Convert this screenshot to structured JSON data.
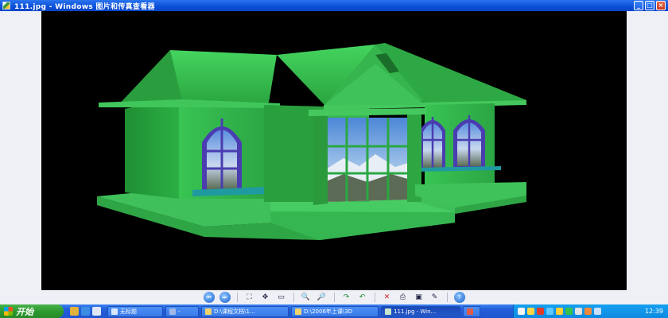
{
  "window": {
    "title": "111.jpg - Windows 图片和传真查看器",
    "minimize": "_",
    "maximize": "□",
    "close": "×"
  },
  "viewer": {
    "image_subject": "3D rendered green house"
  },
  "toolbar": {
    "buttons": [
      {
        "name": "previous-image-button",
        "icon": "prev-icon",
        "glyph": "⏮"
      },
      {
        "name": "next-image-button",
        "icon": "next-icon",
        "glyph": "⏭"
      },
      {
        "name": "best-fit-button",
        "icon": "best-fit-icon",
        "glyph": "⛶"
      },
      {
        "name": "actual-size-button",
        "icon": "actual-size-icon",
        "glyph": "✥"
      },
      {
        "name": "slideshow-button",
        "icon": "slideshow-icon",
        "glyph": "▭"
      },
      {
        "name": "zoom-in-button",
        "icon": "zoom-in-icon",
        "glyph": "🔍"
      },
      {
        "name": "zoom-out-button",
        "icon": "zoom-out-icon",
        "glyph": "🔎"
      },
      {
        "name": "rotate-clockwise-button",
        "icon": "rotate-cw-icon",
        "glyph": "↷"
      },
      {
        "name": "rotate-counterclockwise-button",
        "icon": "rotate-ccw-icon",
        "glyph": "↶"
      },
      {
        "name": "delete-button",
        "icon": "delete-icon",
        "glyph": "✕"
      },
      {
        "name": "print-button",
        "icon": "print-icon",
        "glyph": "⎙"
      },
      {
        "name": "save-button",
        "icon": "save-icon",
        "glyph": "▣"
      },
      {
        "name": "edit-button",
        "icon": "edit-icon",
        "glyph": "✎"
      },
      {
        "name": "help-button",
        "icon": "help-icon",
        "glyph": "?"
      }
    ]
  },
  "taskbar": {
    "start_label": "开始",
    "tasks": [
      {
        "label": "无标题",
        "icon_color": "#d7e8ff"
      },
      {
        "label": "-",
        "icon_color": "#9fb8e8"
      },
      {
        "label": "D:\\课程文档\\1...",
        "icon_color": "#f2d36b"
      },
      {
        "label": "D:\\2006年上课\\3D",
        "icon_color": "#f2d36b"
      },
      {
        "label": "111.jpg - Win...",
        "icon_color": "#c8e6c9",
        "active": true
      },
      {
        "label": "",
        "icon_color": "#e25b4a"
      }
    ],
    "clock": "12:39"
  },
  "colors": {
    "titlebar": "#0a4fd8",
    "taskbar": "#245edb",
    "start": "#2e9a30",
    "tray": "#0e8ae0",
    "house_green": "#2fb84a"
  }
}
